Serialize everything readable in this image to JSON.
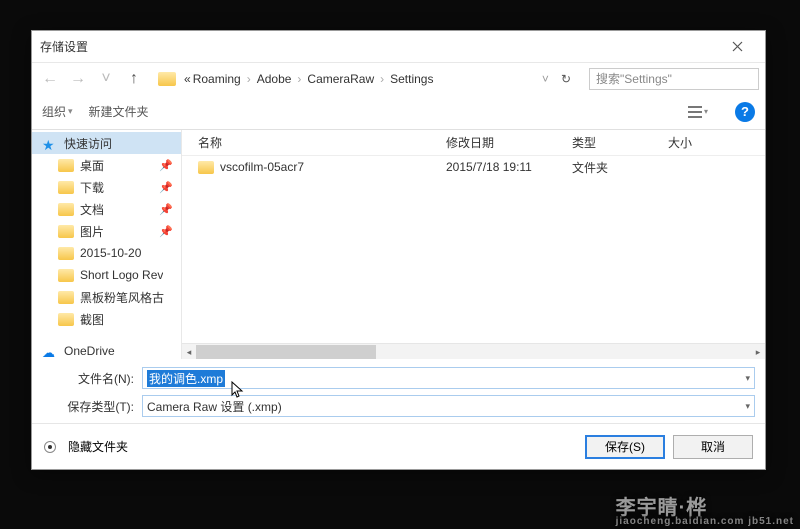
{
  "title": "存储设置",
  "breadcrumb": {
    "pre": "«",
    "parts": [
      "Roaming",
      "Adobe",
      "CameraRaw",
      "Settings"
    ]
  },
  "search": {
    "placeholder": "搜索\"Settings\""
  },
  "toolbar": {
    "organize": "组织",
    "newfolder": "新建文件夹"
  },
  "columns": {
    "name": "名称",
    "date": "修改日期",
    "type": "类型",
    "size": "大小"
  },
  "sidebar": {
    "quick": "快速访问",
    "items": [
      "桌面",
      "下载",
      "文档",
      "图片",
      "2015-10-20",
      "Short Logo Rev",
      "黑板粉笔风格古",
      "截图"
    ],
    "onedrive": "OneDrive"
  },
  "rows": [
    {
      "name": "vscofilm-05acr7",
      "date": "2015/7/18 19:11",
      "type": "文件夹"
    }
  ],
  "fields": {
    "filename_label": "文件名(N):",
    "filename_value": "我的调色.xmp",
    "savetype_label": "保存类型(T):",
    "savetype_value": "Camera Raw 设置 (.xmp)"
  },
  "footer": {
    "hide_folders": "隐藏文件夹",
    "save": "保存(S)",
    "cancel": "取消"
  },
  "watermark": {
    "main": "李宇睛·桦",
    "sub": "jiaocheng.baidian.com  jb51.net"
  }
}
